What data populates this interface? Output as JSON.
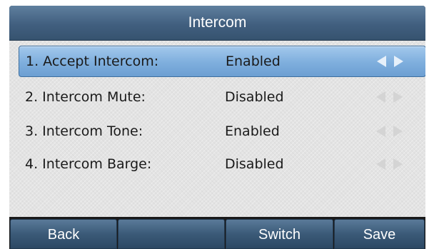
{
  "header": {
    "title": "Intercom"
  },
  "settings": [
    {
      "label": "1. Accept Intercom:",
      "value": "Enabled",
      "selected": true
    },
    {
      "label": "2. Intercom Mute:",
      "value": "Disabled",
      "selected": false
    },
    {
      "label": "3. Intercom Tone:",
      "value": "Enabled",
      "selected": false
    },
    {
      "label": "4. Intercom Barge:",
      "value": "Disabled",
      "selected": false
    }
  ],
  "softkeys": [
    "Back",
    "",
    "Switch",
    "Save"
  ],
  "icons": {
    "prev": "left-arrow-icon",
    "next": "right-arrow-icon"
  },
  "colors": {
    "title_bar": "#415f7f",
    "selection": "#7eaedd",
    "softkey": "#3b5a78"
  }
}
